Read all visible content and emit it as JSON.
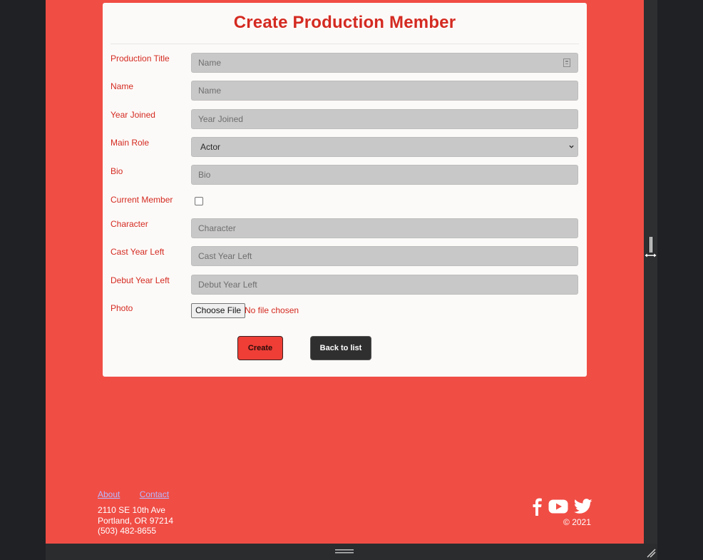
{
  "form": {
    "title": "Create Production Member",
    "production_title": {
      "label": "Production Title",
      "placeholder": "Name"
    },
    "name": {
      "label": "Name",
      "placeholder": "Name"
    },
    "year_joined": {
      "label": "Year Joined",
      "placeholder": "Year Joined"
    },
    "main_role": {
      "label": "Main Role",
      "value": "Actor"
    },
    "bio": {
      "label": "Bio",
      "placeholder": "Bio"
    },
    "current_member": {
      "label": "Current Member",
      "checked": false
    },
    "character": {
      "label": "Character",
      "placeholder": "Character"
    },
    "cast_year_left": {
      "label": "Cast Year Left",
      "placeholder": "Cast Year Left"
    },
    "debut_year_left": {
      "label": "Debut Year Left",
      "placeholder": "Debut Year Left"
    },
    "photo": {
      "label": "Photo",
      "button": "Choose File",
      "status": "No file chosen"
    },
    "create_label": "Create",
    "back_label": "Back to list"
  },
  "footer": {
    "links": [
      "About",
      "Contact"
    ],
    "address": [
      "2110 SE 10th Ave",
      "Portland, OR 97214",
      "(503) 482-8655"
    ],
    "social_icons": [
      "facebook-icon",
      "youtube-icon",
      "twitter-icon"
    ],
    "copyright": "2021"
  },
  "colors": {
    "page_bg": "#f04d45",
    "accent_text": "#d42a21",
    "card_bg": "#fcfaf8",
    "input_bg": "#c8c8c8",
    "dark_button": "#2f2f2f"
  }
}
